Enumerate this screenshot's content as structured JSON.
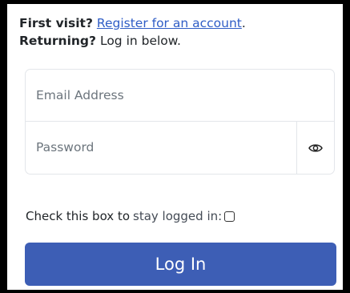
{
  "intro": {
    "first_visit_label": "First visit?",
    "register_link": "Register for an account",
    "register_suffix": ".",
    "returning_label": "Returning?",
    "returning_text": "Log in below."
  },
  "form": {
    "email_placeholder": "Email Address",
    "password_placeholder": "Password",
    "show_password_icon": "eye-icon"
  },
  "stay_logged_in": {
    "prefix": "Check this box to",
    "highlight": "stay logged in:",
    "checked": false
  },
  "login_button": {
    "label": "Log In"
  },
  "colors": {
    "link": "#2f5dc6",
    "button": "#3d5eb5",
    "frame": "#000000"
  }
}
